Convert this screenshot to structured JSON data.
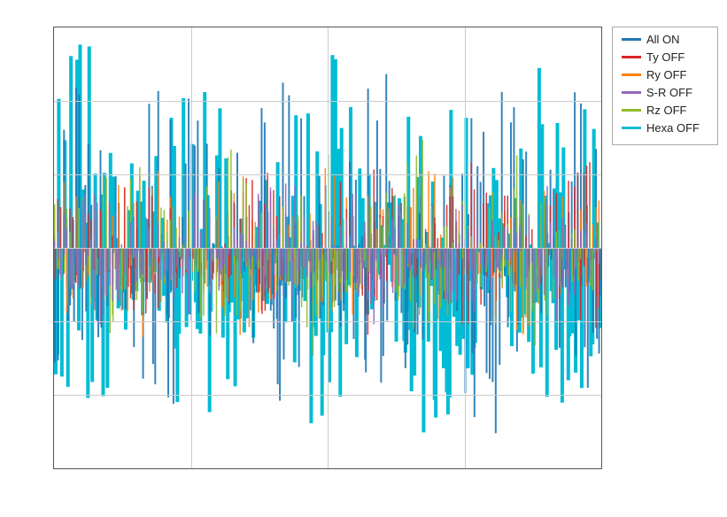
{
  "chart": {
    "title": "",
    "background": "#ffffff",
    "border_color": "#555555",
    "grid_color": "#cccccc"
  },
  "legend": {
    "items": [
      {
        "label": "All ON",
        "color": "#1f77b4",
        "thickness": 3
      },
      {
        "label": "Ty OFF",
        "color": "#d62728",
        "thickness": 3
      },
      {
        "label": "Ry OFF",
        "color": "#ff7f0e",
        "thickness": 3
      },
      {
        "label": "S-R OFF",
        "color": "#9467bd",
        "thickness": 3
      },
      {
        "label": "Rz OFF",
        "color": "#8fbc2b",
        "thickness": 3
      },
      {
        "label": "Hexa OFF",
        "color": "#17becf",
        "thickness": 3
      }
    ]
  },
  "axes": {
    "x_ticks": [],
    "y_ticks": []
  }
}
